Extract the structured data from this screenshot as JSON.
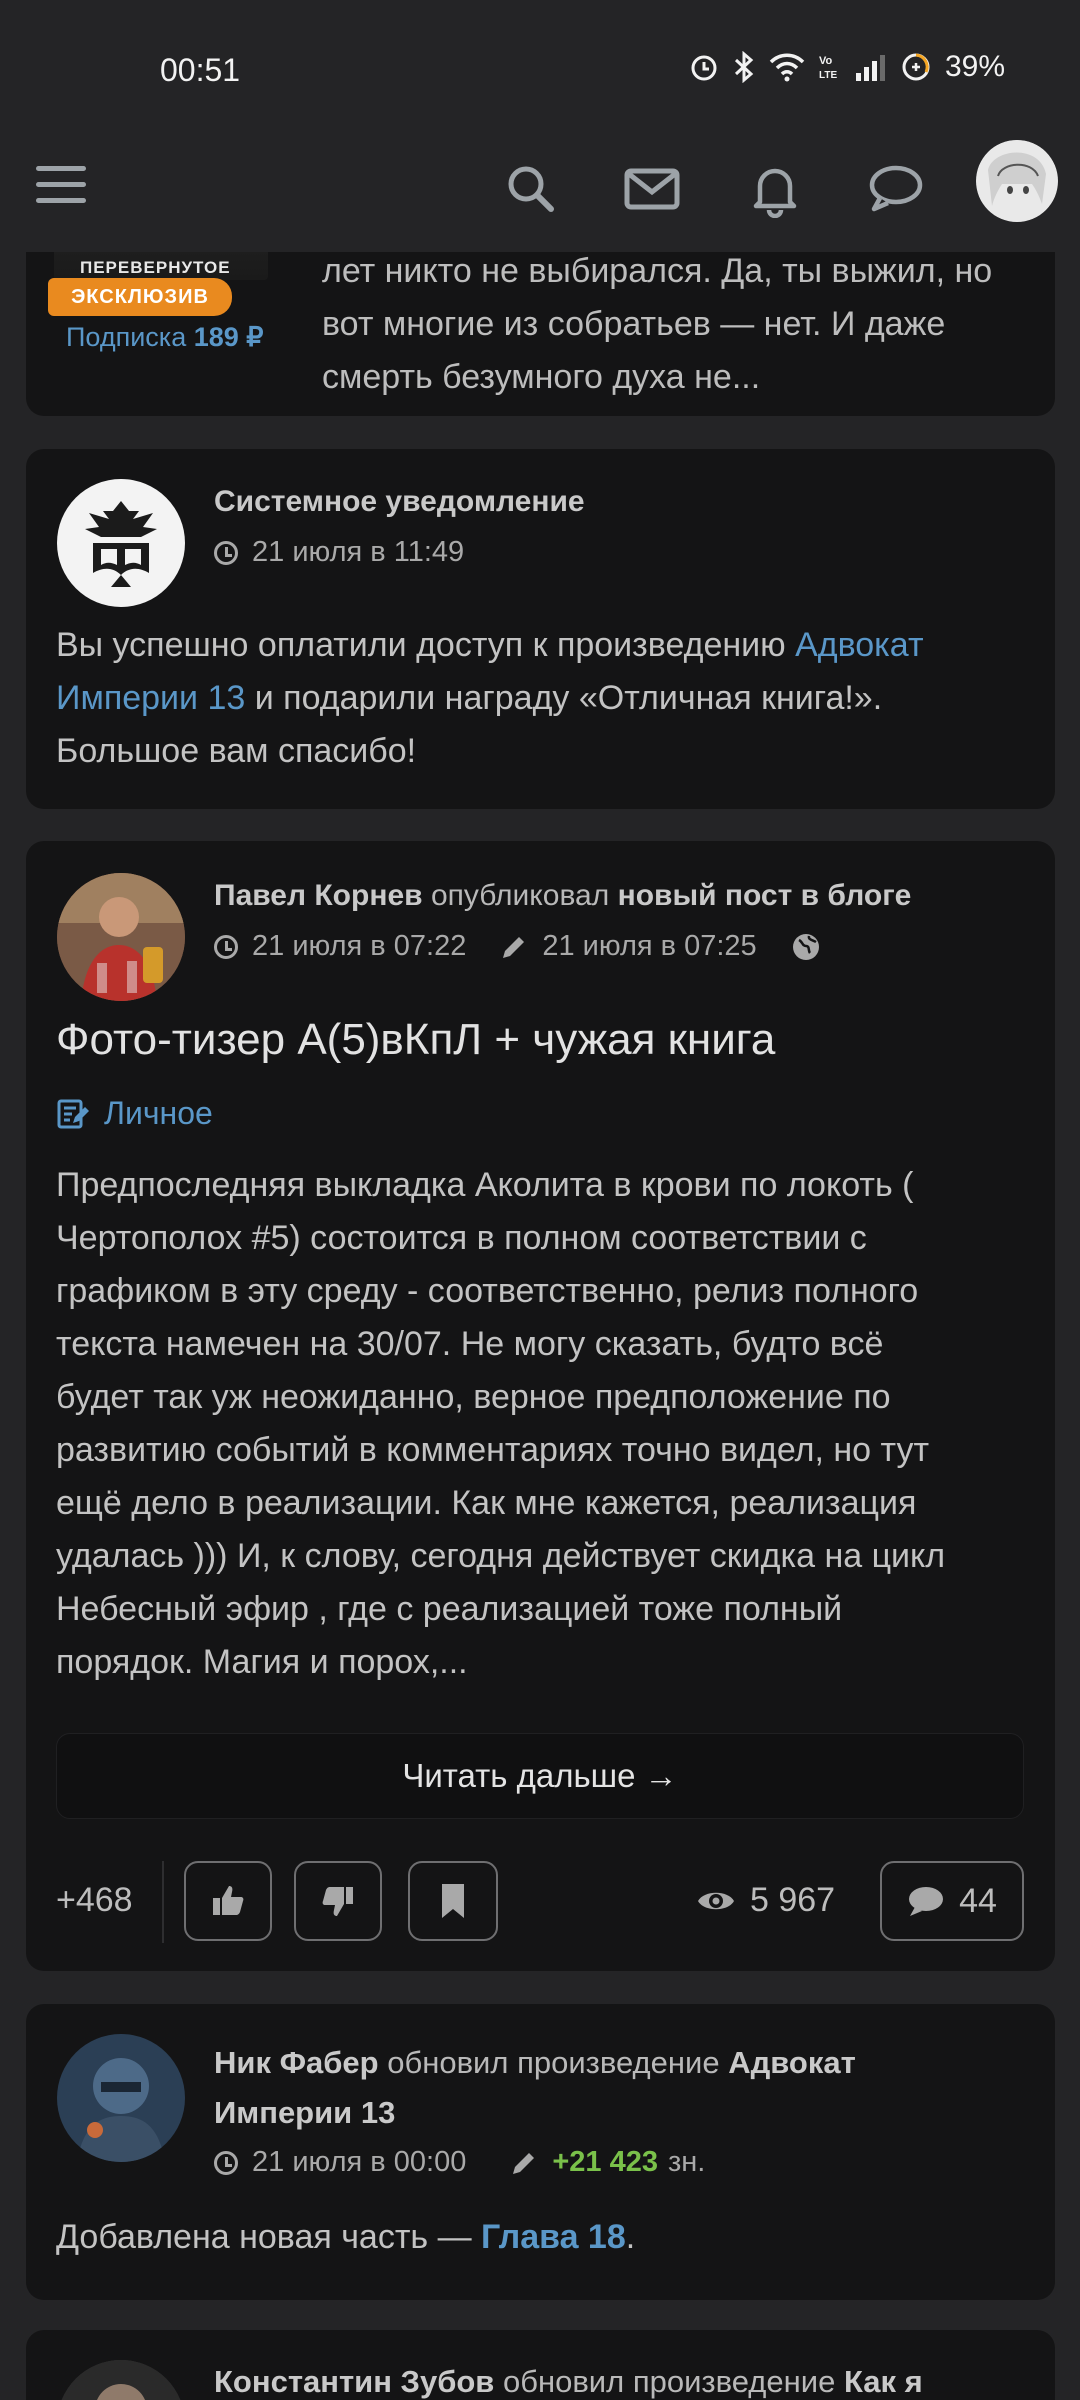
{
  "status_bar": {
    "time": "00:51",
    "battery": "39%"
  },
  "header": {
    "menu_icon": "hamburger-icon",
    "icons": [
      "search-icon",
      "mail-icon",
      "bell-icon",
      "chat-icon"
    ]
  },
  "card0": {
    "cover_title": "ПЕРЕВЕРНУТОЕ НЕБО",
    "badge": "ЭКСКЛЮЗИВ",
    "subscription_label": "Подписка",
    "subscription_price": "189 ₽",
    "text_lines": [
      "лет никто не выбирался. Да, ты выжил, но",
      "вот многие из собратьев — нет. И даже",
      "смерть безумного духа не..."
    ]
  },
  "card1": {
    "author": "Системное уведомление",
    "time": "21 июля в 11:49",
    "text_before": "Вы успешно оплатили доступ к произведению ",
    "link_line1": "Адвокат",
    "link_line2": "Империи 13",
    "text_after": " и подарили награду «Отличная книга!».",
    "text_line3": "Большое вам спасибо!"
  },
  "card2": {
    "author": "Павел Корнев",
    "action": "опубликовал",
    "target": "новый пост в блоге",
    "published": "21 июля в 07:22",
    "edited": "21 июля в 07:25",
    "title": "Фото-тизер А(5)вКпЛ + чужая книга",
    "category": "Личное",
    "paragraph_lines": [
      "Предпоследняя выкладка Аколита в крови по локоть (",
      "Чертополох #5) состоится в полном соответствии с",
      "графиком в эту среду - соответственно, релиз полного",
      "текста намечен на 30/07. Не могу сказать, будто всё",
      "будет так уж неожиданно, верное предположение по",
      "развитию событий в комментариях точно видел, но тут",
      "ещё дело в реализации. Как мне кажется, реализация",
      "удалась ))) И, к слову, сегодня действует скидка на цикл",
      "Небесный эфир , где с реализацией тоже полный",
      "порядок. Магия и порох,..."
    ],
    "read_more": "Читать дальше →",
    "rating": "+468",
    "views": "5 967",
    "comments": "44"
  },
  "card3": {
    "author": "Ник Фабер",
    "action": "обновил произведение",
    "work_line1": "Адвокат",
    "work_line2": "Империи 13",
    "time": "21 июля в 00:00",
    "delta": "+21 423",
    "delta_unit": "зн.",
    "text_before": "Добавлена новая часть — ",
    "chapter": "Глава 18",
    "text_after": "."
  },
  "card4": {
    "author": "Константин Зубов",
    "action": "обновил произведение",
    "work": "Как я"
  }
}
